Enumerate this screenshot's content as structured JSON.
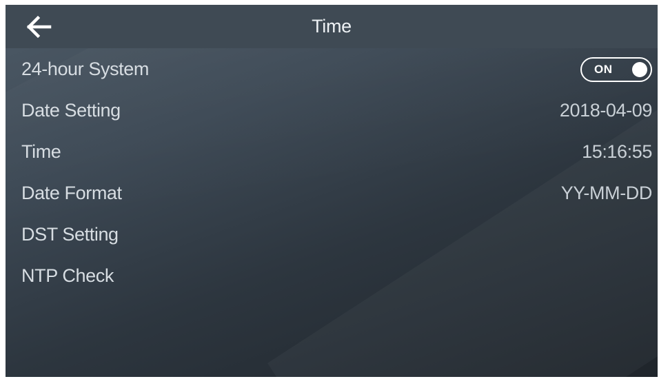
{
  "header": {
    "title": "Time",
    "back_icon": "back-arrow-icon"
  },
  "settings": {
    "hour_system": {
      "label": "24-hour System",
      "toggle_text": "ON",
      "enabled": true
    },
    "date_setting": {
      "label": "Date Setting",
      "value": "2018-04-09"
    },
    "time": {
      "label": "Time",
      "value": "15:16:55"
    },
    "date_format": {
      "label": "Date Format",
      "value": "YY-MM-DD"
    },
    "dst_setting": {
      "label": "DST Setting"
    },
    "ntp_check": {
      "label": "NTP Check"
    }
  },
  "colors": {
    "header_bg": "#3f4a54",
    "text": "#d7dde2",
    "toggle": "#ffffff"
  }
}
